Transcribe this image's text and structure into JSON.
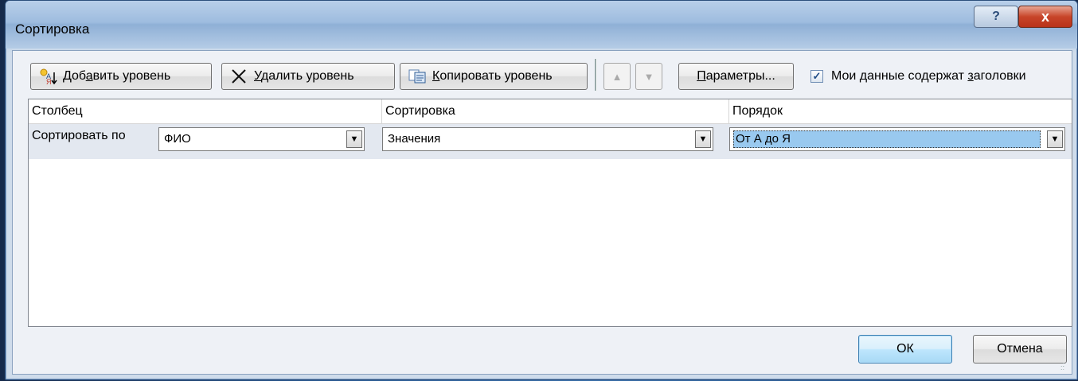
{
  "dialog": {
    "title": "Сортировка",
    "help_label": "?",
    "close_label": "x"
  },
  "toolbar": {
    "add_level": {
      "pre": "Доб",
      "ul": "а",
      "post": "вить уровень"
    },
    "delete_level": {
      "pre": "",
      "ul": "У",
      "post": "далить уровень"
    },
    "copy_level": {
      "pre": "",
      "ul": "К",
      "post": "опировать уровень"
    },
    "move_up_glyph": "▲",
    "move_down_glyph": "▼",
    "params": {
      "pre": "",
      "ul": "П",
      "post": "араметры..."
    },
    "headers_checkbox": {
      "pre": "Мои данные содержат ",
      "ul": "з",
      "post": "аголовки",
      "checked": true
    }
  },
  "grid": {
    "columns": [
      "Столбец",
      "Сортировка",
      "Порядок"
    ],
    "rows": [
      {
        "label": "Сортировать по",
        "column_value": "ФИО",
        "sort_on_value": "Значения",
        "order_value": "От А до Я"
      }
    ]
  },
  "footer": {
    "ok_label": "ОК",
    "cancel_label": "Отмена"
  },
  "colors": {
    "selection": "#99c9ef",
    "row_bg": "#e3e8f0",
    "close_button": "#c8452a"
  },
  "icons": {
    "add": "sort-add-icon",
    "delete": "delete-x-icon",
    "copy": "copy-icon",
    "help": "help-icon",
    "close": "close-icon",
    "dropdown": "chevron-down-icon",
    "check": "checkmark-icon"
  }
}
